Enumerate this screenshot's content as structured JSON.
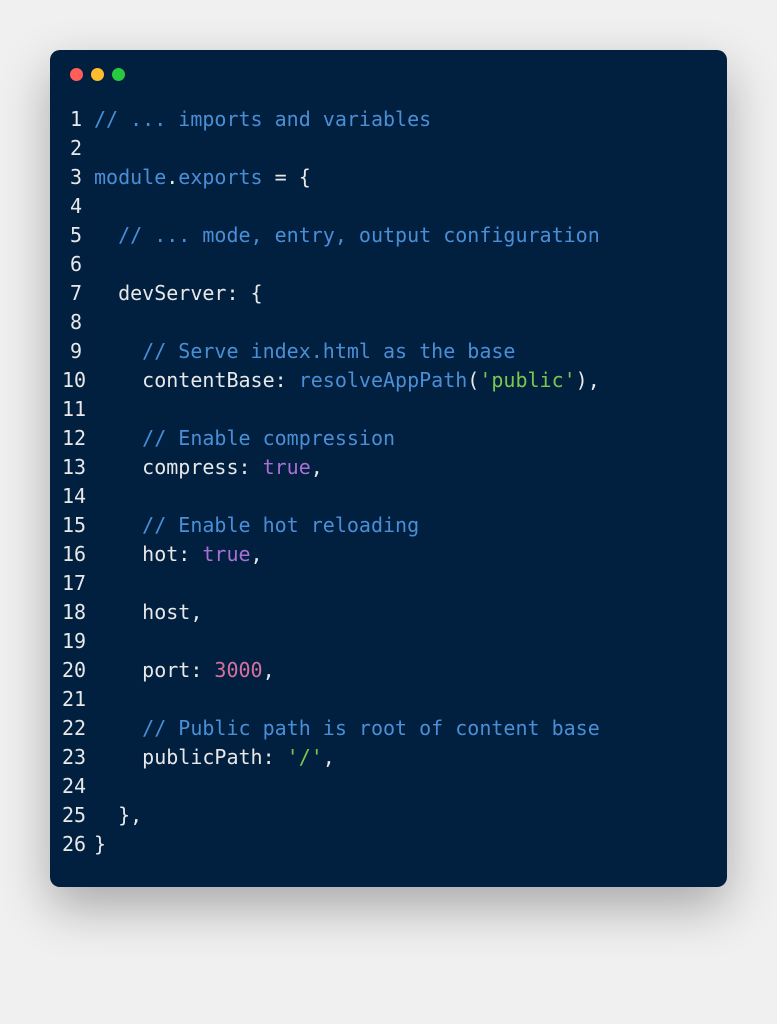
{
  "window": {
    "controls": [
      "close",
      "minimize",
      "maximize"
    ]
  },
  "code": {
    "lines": [
      {
        "num": "1",
        "tokens": [
          {
            "t": "// ... imports and variables",
            "c": "tk-comment"
          }
        ]
      },
      {
        "num": "2",
        "tokens": []
      },
      {
        "num": "3",
        "tokens": [
          {
            "t": "module",
            "c": "tk-keyword"
          },
          {
            "t": ".",
            "c": "tk-punct"
          },
          {
            "t": "exports",
            "c": "tk-keyword"
          },
          {
            "t": " = {",
            "c": "tk-punct"
          }
        ]
      },
      {
        "num": "4",
        "tokens": []
      },
      {
        "num": "5",
        "tokens": [
          {
            "t": "  ",
            "c": ""
          },
          {
            "t": "// ... mode, entry, output configuration",
            "c": "tk-comment"
          }
        ]
      },
      {
        "num": "6",
        "tokens": []
      },
      {
        "num": "7",
        "tokens": [
          {
            "t": "  devServer: {",
            "c": "tk-property"
          }
        ]
      },
      {
        "num": "8",
        "tokens": []
      },
      {
        "num": "9",
        "tokens": [
          {
            "t": "    ",
            "c": ""
          },
          {
            "t": "// Serve index.html as the base",
            "c": "tk-comment"
          }
        ]
      },
      {
        "num": "10",
        "tokens": [
          {
            "t": "    contentBase: ",
            "c": "tk-property"
          },
          {
            "t": "resolveAppPath",
            "c": "tk-func"
          },
          {
            "t": "(",
            "c": "tk-punct"
          },
          {
            "t": "'public'",
            "c": "tk-string"
          },
          {
            "t": "),",
            "c": "tk-punct"
          }
        ]
      },
      {
        "num": "11",
        "tokens": []
      },
      {
        "num": "12",
        "tokens": [
          {
            "t": "    ",
            "c": ""
          },
          {
            "t": "// Enable compression",
            "c": "tk-comment"
          }
        ]
      },
      {
        "num": "13",
        "tokens": [
          {
            "t": "    compress: ",
            "c": "tk-property"
          },
          {
            "t": "true",
            "c": "tk-boolean"
          },
          {
            "t": ",",
            "c": "tk-punct"
          }
        ]
      },
      {
        "num": "14",
        "tokens": []
      },
      {
        "num": "15",
        "tokens": [
          {
            "t": "    ",
            "c": ""
          },
          {
            "t": "// Enable hot reloading",
            "c": "tk-comment"
          }
        ]
      },
      {
        "num": "16",
        "tokens": [
          {
            "t": "    hot: ",
            "c": "tk-property"
          },
          {
            "t": "true",
            "c": "tk-boolean"
          },
          {
            "t": ",",
            "c": "tk-punct"
          }
        ]
      },
      {
        "num": "17",
        "tokens": []
      },
      {
        "num": "18",
        "tokens": [
          {
            "t": "    host,",
            "c": "tk-property"
          }
        ]
      },
      {
        "num": "19",
        "tokens": []
      },
      {
        "num": "20",
        "tokens": [
          {
            "t": "    port: ",
            "c": "tk-property"
          },
          {
            "t": "3000",
            "c": "tk-number"
          },
          {
            "t": ",",
            "c": "tk-punct"
          }
        ]
      },
      {
        "num": "21",
        "tokens": []
      },
      {
        "num": "22",
        "tokens": [
          {
            "t": "    ",
            "c": ""
          },
          {
            "t": "// Public path is root of content base",
            "c": "tk-comment"
          }
        ]
      },
      {
        "num": "23",
        "tokens": [
          {
            "t": "    publicPath: ",
            "c": "tk-property"
          },
          {
            "t": "'/'",
            "c": "tk-string"
          },
          {
            "t": ",",
            "c": "tk-punct"
          }
        ]
      },
      {
        "num": "24",
        "tokens": []
      },
      {
        "num": "25",
        "tokens": [
          {
            "t": "  },",
            "c": "tk-punct"
          }
        ]
      },
      {
        "num": "26",
        "tokens": [
          {
            "t": "}",
            "c": "tk-punct"
          }
        ]
      }
    ]
  }
}
